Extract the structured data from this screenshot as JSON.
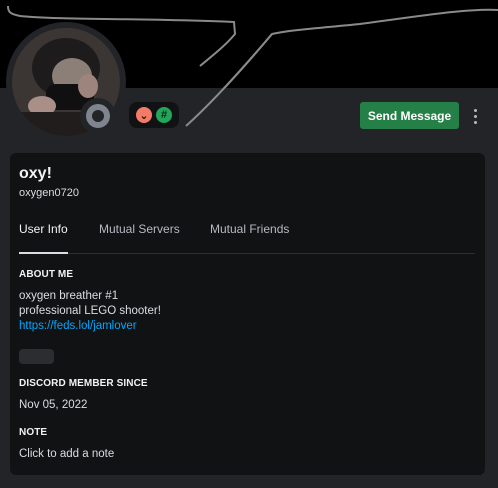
{
  "profile": {
    "display_name": "oxy!",
    "username": "oxygen0720",
    "status": "offline",
    "badges": [
      {
        "name": "hypesquad-badge",
        "glyph": "⌄",
        "color": "#f47b67"
      },
      {
        "name": "hashtag-badge",
        "glyph": "#",
        "color": "#23a55a"
      }
    ]
  },
  "actions": {
    "send_message": "Send Message"
  },
  "tabs": [
    {
      "label": "User Info",
      "active": true
    },
    {
      "label": "Mutual Servers",
      "active": false
    },
    {
      "label": "Mutual Friends",
      "active": false
    }
  ],
  "about": {
    "title": "ABOUT ME",
    "lines": [
      "oxygen breather #1",
      "professional LEGO shooter!"
    ],
    "link": "https://feds.lol/jamlover"
  },
  "member_since": {
    "title": "DISCORD MEMBER SINCE",
    "date": "Nov 05, 2022"
  },
  "note": {
    "title": "NOTE",
    "placeholder": "Click to add a note"
  },
  "colors": {
    "accent_button": "#248046",
    "link": "#00a8fc",
    "background": "#232428",
    "card": "#111214"
  }
}
